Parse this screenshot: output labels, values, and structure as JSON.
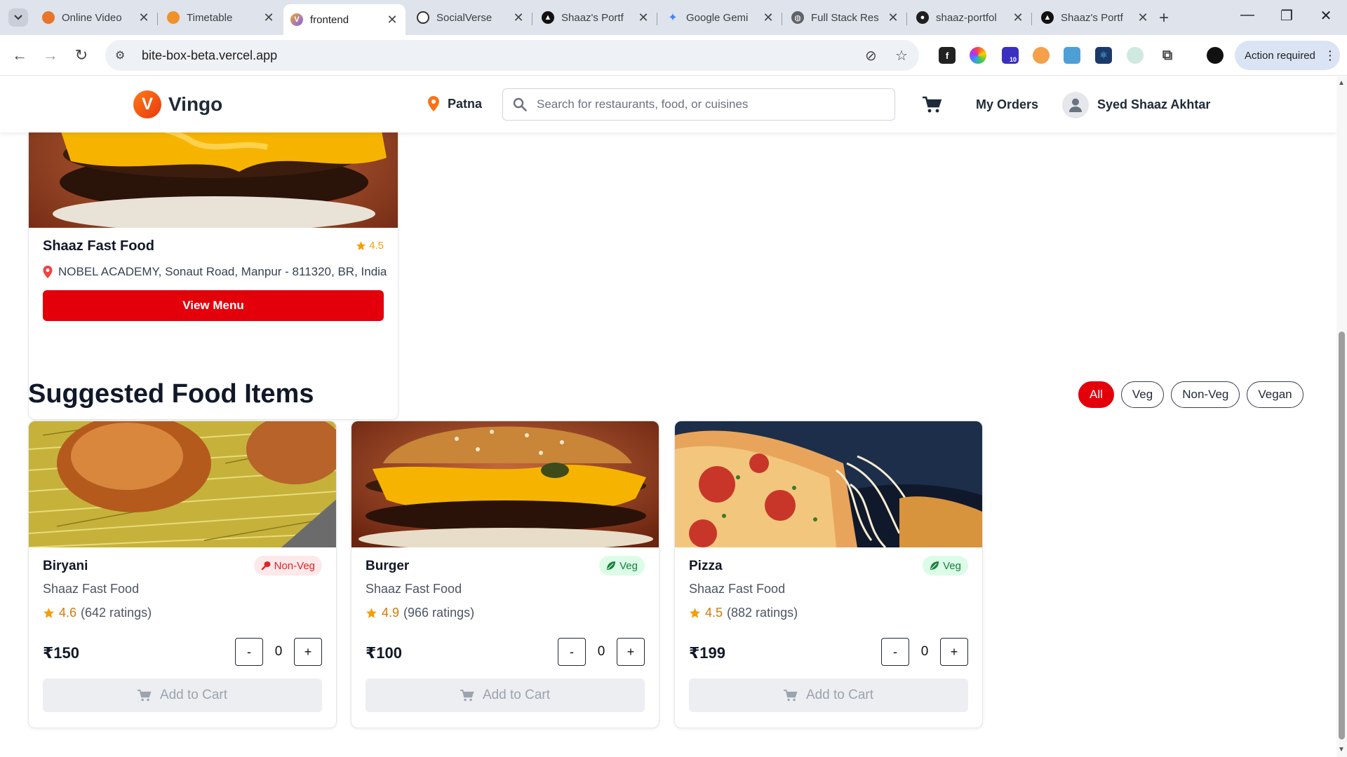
{
  "browser": {
    "tabs": [
      {
        "title": "Online Video",
        "favicon": "orange-circle-icon"
      },
      {
        "title": "Timetable",
        "favicon": "orange-flower-icon"
      },
      {
        "title": "frontend",
        "favicon": "vercel-v-icon"
      },
      {
        "title": "SocialVerse",
        "favicon": "target-icon"
      },
      {
        "title": "Shaaz's Portf",
        "favicon": "vercel-triangle-icon"
      },
      {
        "title": "Google Gemi",
        "favicon": "gemini-icon"
      },
      {
        "title": "Full Stack Res",
        "favicon": "globe-icon"
      },
      {
        "title": "shaaz-portfol",
        "favicon": "github-icon"
      },
      {
        "title": "Shaaz's Portf",
        "favicon": "vercel-triangle-icon"
      }
    ],
    "url": "bite-box-beta.vercel.app",
    "extension_badge": "10",
    "action_required": "Action required"
  },
  "header": {
    "logo_letter": "V",
    "brand": "Vingo",
    "location": "Patna",
    "search_placeholder": "Search for restaurants, food, or cuisines",
    "my_orders": "My Orders",
    "username": "Syed Shaaz Akhtar"
  },
  "restaurant": {
    "name": "Shaaz Fast Food",
    "rating": "4.5",
    "address": "NOBEL ACADEMY, Sonaut Road, Manpur - 811320, BR, India",
    "button": "View Menu"
  },
  "suggested": {
    "title": "Suggested Food Items",
    "filters": [
      "All",
      "Veg",
      "Non-Veg",
      "Vegan"
    ],
    "items": [
      {
        "name": "Biryani",
        "type": "Non-Veg",
        "restaurant": "Shaaz Fast Food",
        "rating": "4.6",
        "ratings_count": "(642 ratings)",
        "price": "₹150",
        "qty": "0",
        "minus": "-",
        "plus": "+",
        "add_to_cart": "Add to Cart"
      },
      {
        "name": "Burger",
        "type": "Veg",
        "restaurant": "Shaaz Fast Food",
        "rating": "4.9",
        "ratings_count": "(966 ratings)",
        "price": "₹100",
        "qty": "0",
        "minus": "-",
        "plus": "+",
        "add_to_cart": "Add to Cart"
      },
      {
        "name": "Pizza",
        "type": "Veg",
        "restaurant": "Shaaz Fast Food",
        "rating": "4.5",
        "ratings_count": "(882 ratings)",
        "price": "₹199",
        "qty": "0",
        "minus": "-",
        "plus": "+",
        "add_to_cart": "Add to Cart"
      }
    ]
  },
  "colors": {
    "accent": "#e3000b",
    "logo": "#f25c0f",
    "star": "#f59e0b",
    "veg": "#15803d",
    "nonveg": "#dc2626"
  }
}
